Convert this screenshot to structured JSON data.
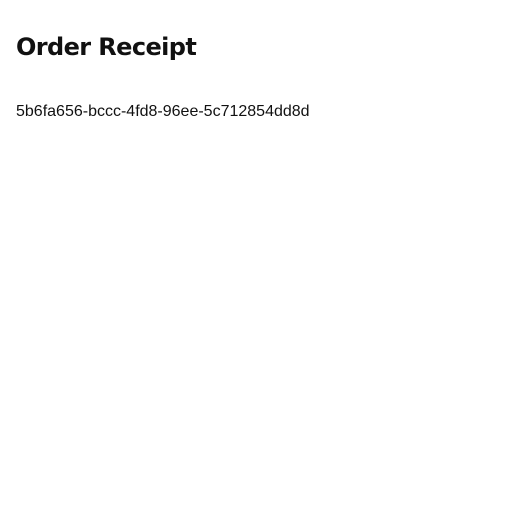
{
  "receipt": {
    "title": "Order Receipt",
    "order_id": "5b6fa656-bccc-4fd8-96ee-5c712854dd8d"
  },
  "colors": {
    "background": "#ffffff",
    "text": "#111111"
  }
}
